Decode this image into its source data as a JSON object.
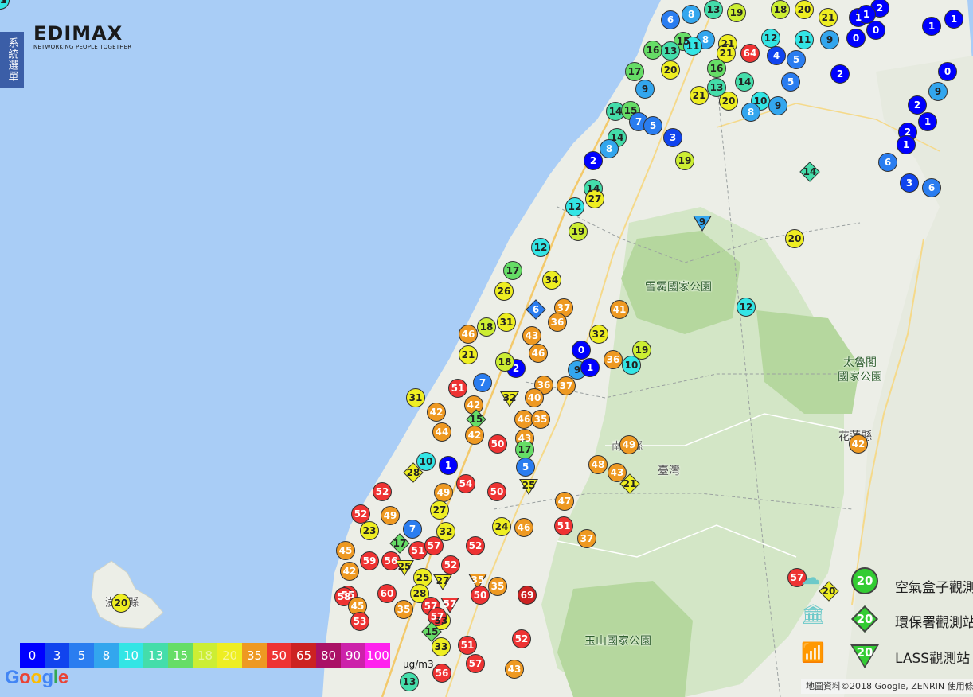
{
  "menu_tab": "系統選單",
  "logo": {
    "brand": "EDIMAX",
    "tagline": "NETWORKING PEOPLE TOGETHER"
  },
  "places": [
    {
      "name": "雪霸國家公園",
      "kind": "park"
    },
    {
      "name": "太魯閣\n國家公園",
      "kind": "park"
    },
    {
      "name": "玉山國家公園",
      "kind": "park"
    },
    {
      "name": "臺灣",
      "kind": "country"
    },
    {
      "name": "花蓮縣",
      "kind": "county"
    },
    {
      "name": "南投縣",
      "kind": "county"
    },
    {
      "name": "澎湖縣",
      "kind": "county"
    }
  ],
  "scale": {
    "stops": [
      {
        "label": "0",
        "color": "#0000ff"
      },
      {
        "label": "3",
        "color": "#1144ee"
      },
      {
        "label": "5",
        "color": "#2a7df0"
      },
      {
        "label": "8",
        "color": "#33a6ee"
      },
      {
        "label": "10",
        "color": "#33e5e5"
      },
      {
        "label": "13",
        "color": "#44ddaa"
      },
      {
        "label": "15",
        "color": "#66dd66"
      },
      {
        "label": "18",
        "color": "#ccee33"
      },
      {
        "label": "20",
        "color": "#eeee22"
      },
      {
        "label": "35",
        "color": "#ee9922"
      },
      {
        "label": "50",
        "color": "#ee3333"
      },
      {
        "label": "65",
        "color": "#cc2222"
      },
      {
        "label": "80",
        "color": "#aa1166"
      },
      {
        "label": "90",
        "color": "#cc22aa"
      },
      {
        "label": "100",
        "color": "#ff22ee"
      }
    ],
    "unit": "μg/m3"
  },
  "legend": [
    {
      "shape": "circle",
      "value": "20",
      "label": "空氣盒子觀測站"
    },
    {
      "shape": "diamond",
      "value": "20",
      "label": "環保署觀測站"
    },
    {
      "shape": "triangle",
      "value": "20",
      "label": "LASS觀測站"
    }
  ],
  "attribution": "地圖資料©2018 Google, ZENRIN   使用條款",
  "google_logo": "Google",
  "stations": [
    [
      "circle",
      6
    ],
    [
      "circle",
      8
    ],
    [
      "circle",
      13
    ],
    [
      "circle",
      19
    ],
    [
      "circle",
      18
    ],
    [
      "circle",
      20
    ],
    [
      "circle",
      21
    ],
    [
      "circle",
      1
    ],
    [
      "circle",
      2
    ],
    [
      "circle",
      1
    ],
    [
      "circle",
      1
    ],
    [
      "circle",
      15
    ],
    [
      "circle",
      8
    ],
    [
      "circle",
      21
    ],
    [
      "circle",
      12
    ],
    [
      "circle",
      11
    ],
    [
      "circle",
      9
    ],
    [
      "circle",
      0
    ],
    [
      "circle",
      1
    ],
    [
      "circle",
      0
    ],
    [
      "circle",
      16
    ],
    [
      "circle",
      13
    ],
    [
      "circle",
      11
    ],
    [
      "circle",
      21
    ],
    [
      "circle",
      64
    ],
    [
      "circle",
      4
    ],
    [
      "circle",
      5
    ],
    [
      "circle",
      2
    ],
    [
      "circle",
      0
    ],
    [
      "circle",
      17
    ],
    [
      "circle",
      20
    ],
    [
      "circle",
      16
    ],
    [
      "circle",
      9
    ],
    [
      "circle",
      13
    ],
    [
      "circle",
      14
    ],
    [
      "circle",
      5
    ],
    [
      "circle",
      9
    ],
    [
      "circle",
      21
    ],
    [
      "circle",
      20
    ],
    [
      "circle",
      10
    ],
    [
      "circle",
      9
    ],
    [
      "circle",
      8
    ],
    [
      "circle",
      2
    ],
    [
      "circle",
      1
    ],
    [
      "circle",
      14
    ],
    [
      "circle",
      15
    ],
    [
      "circle",
      7
    ],
    [
      "circle",
      5
    ],
    [
      "circle",
      2
    ],
    [
      "circle",
      14
    ],
    [
      "circle",
      8
    ],
    [
      "circle",
      19
    ],
    [
      "circle",
      6
    ],
    [
      "circle",
      1
    ],
    [
      "circle",
      3
    ],
    [
      "circle",
      6
    ],
    [
      "circle",
      3
    ],
    [
      "circle",
      2
    ],
    [
      "diamond",
      14
    ],
    [
      "circle",
      14
    ],
    [
      "circle",
      12
    ],
    [
      "circle",
      27
    ],
    [
      "circle",
      19
    ],
    [
      "triangle",
      9
    ],
    [
      "circle",
      20
    ],
    [
      "circle",
      12
    ],
    [
      "circle",
      17
    ],
    [
      "circle",
      34
    ],
    [
      "circle",
      26
    ],
    [
      "diamond",
      6
    ],
    [
      "circle",
      37
    ],
    [
      "circle",
      41
    ],
    [
      "circle",
      31
    ],
    [
      "circle",
      18
    ],
    [
      "circle",
      46
    ],
    [
      "circle",
      43
    ],
    [
      "circle",
      36
    ],
    [
      "circle",
      32
    ],
    [
      "circle",
      12
    ],
    [
      "circle",
      21
    ],
    [
      "circle",
      46
    ],
    [
      "circle",
      0
    ],
    [
      "circle",
      36
    ],
    [
      "circle",
      19
    ],
    [
      "circle",
      10
    ],
    [
      "circle",
      9
    ],
    [
      "circle",
      1
    ],
    [
      "circle",
      2
    ],
    [
      "circle",
      18
    ],
    [
      "circle",
      7
    ],
    [
      "circle",
      36
    ],
    [
      "circle",
      51
    ],
    [
      "circle",
      37
    ],
    [
      "circle",
      31
    ],
    [
      "circle",
      42
    ],
    [
      "circle",
      42
    ],
    [
      "triangle",
      32
    ],
    [
      "circle",
      40
    ],
    [
      "diamond",
      15
    ],
    [
      "circle",
      46
    ],
    [
      "circle",
      35
    ],
    [
      "circle",
      44
    ],
    [
      "circle",
      42
    ],
    [
      "circle",
      50
    ],
    [
      "circle",
      43
    ],
    [
      "circle",
      17
    ],
    [
      "circle",
      49
    ],
    [
      "circle",
      48
    ],
    [
      "circle",
      43
    ],
    [
      "diamond",
      21
    ],
    [
      "circle",
      10
    ],
    [
      "circle",
      1
    ],
    [
      "circle",
      5
    ],
    [
      "diamond",
      28
    ],
    [
      "circle",
      54
    ],
    [
      "circle",
      52
    ],
    [
      "circle",
      49
    ],
    [
      "circle",
      50
    ],
    [
      "triangle",
      25
    ],
    [
      "circle",
      47
    ],
    [
      "circle",
      49
    ],
    [
      "circle",
      27
    ],
    [
      "circle",
      24
    ],
    [
      "circle",
      46
    ],
    [
      "circle",
      51
    ],
    [
      "circle",
      37
    ],
    [
      "circle",
      52
    ],
    [
      "circle",
      23
    ],
    [
      "circle",
      7
    ],
    [
      "circle",
      32
    ],
    [
      "diamond",
      17
    ],
    [
      "circle",
      51
    ],
    [
      "circle",
      57
    ],
    [
      "circle",
      52
    ],
    [
      "circle",
      45
    ],
    [
      "circle",
      59
    ],
    [
      "circle",
      56
    ],
    [
      "triangle",
      25
    ],
    [
      "circle",
      25
    ],
    [
      "circle",
      42
    ],
    [
      "circle",
      55
    ],
    [
      "circle",
      52
    ],
    [
      "triangle",
      35
    ],
    [
      "circle",
      35
    ],
    [
      "triangle",
      27
    ],
    [
      "circle",
      69
    ],
    [
      "circle",
      58
    ],
    [
      "circle",
      60
    ],
    [
      "circle",
      28
    ],
    [
      "circle",
      33
    ],
    [
      "circle",
      50
    ],
    [
      "circle",
      45
    ],
    [
      "circle",
      57
    ],
    [
      "triangle",
      57
    ],
    [
      "circle",
      35
    ],
    [
      "circle",
      53
    ],
    [
      "circle",
      57
    ],
    [
      "diamond",
      15
    ],
    [
      "circle",
      33
    ],
    [
      "circle",
      51
    ],
    [
      "circle",
      52
    ],
    [
      "circle",
      57
    ],
    [
      "circle",
      43
    ],
    [
      "circle",
      13
    ],
    [
      "circle",
      56
    ],
    [
      "circle",
      20
    ],
    [
      "circle",
      42
    ],
    [
      "circle",
      57
    ],
    [
      "diamond",
      20
    ],
    [
      "diamond",
      15
    ],
    [
      "circle",
      11
    ],
    [
      "circle",
      11
    ]
  ]
}
